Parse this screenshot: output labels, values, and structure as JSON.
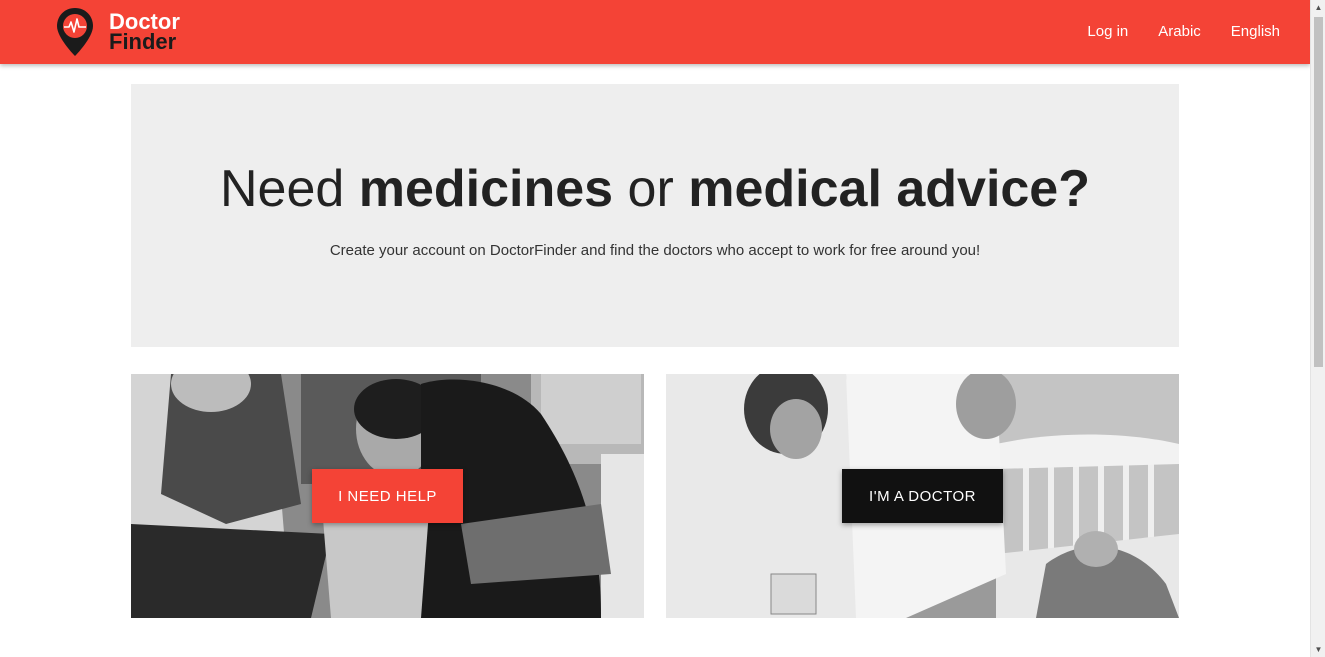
{
  "header": {
    "brand_line1": "Doctor",
    "brand_line2": "Finder",
    "nav": [
      {
        "label": "Log in"
      },
      {
        "label": "Arabic"
      },
      {
        "label": "English"
      }
    ],
    "accent_color": "#f44336"
  },
  "hero": {
    "title_parts": [
      "Need ",
      "medicines",
      " or ",
      "medical advice?"
    ],
    "subtitle": "Create your account on DoctorFinder and find the doctors who accept to work for free around you!"
  },
  "cards": [
    {
      "button_label": "I NEED HELP",
      "button_color": "#f44336"
    },
    {
      "button_label": "I'M A DOCTOR",
      "button_color": "#111111"
    }
  ],
  "icons": {
    "logo": "map-pin-heartbeat-icon",
    "scroll_up": "up-arrow-icon",
    "scroll_down": "down-arrow-icon"
  }
}
